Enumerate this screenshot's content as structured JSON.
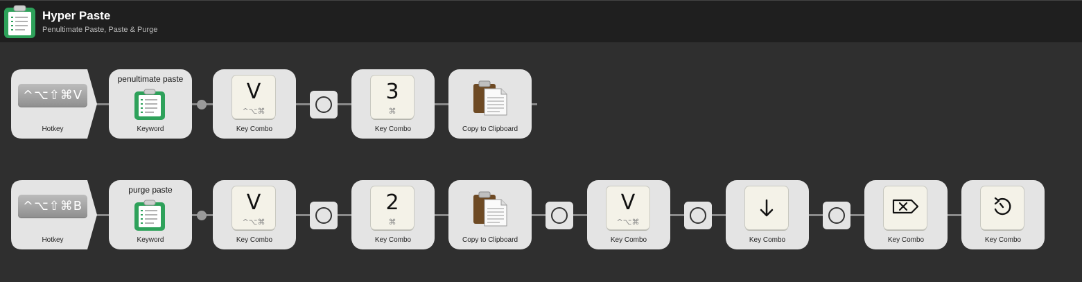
{
  "header": {
    "title": "Hyper Paste",
    "subtitle": "Penultimate Paste, Paste & Purge"
  },
  "rows": [
    {
      "hotkey": {
        "keys": "^⌥⇧⌘V",
        "label": "Hotkey"
      },
      "keyword": {
        "title": "penultimate paste",
        "label": "Keyword"
      },
      "combo1": {
        "key": "V",
        "mods": "^⌥⌘",
        "label": "Key Combo"
      },
      "combo2": {
        "key": "3",
        "mods": "⌘",
        "label": "Key Combo"
      },
      "clipboard": {
        "label": "Copy to Clipboard"
      }
    },
    {
      "hotkey": {
        "keys": "^⌥⇧⌘B",
        "label": "Hotkey"
      },
      "keyword": {
        "title": "purge paste",
        "label": "Keyword"
      },
      "combo1": {
        "key": "V",
        "mods": "^⌥⌘",
        "label": "Key Combo"
      },
      "combo2": {
        "key": "2",
        "mods": "⌘",
        "label": "Key Combo"
      },
      "clipboard": {
        "label": "Copy to Clipboard"
      },
      "combo3": {
        "key": "V",
        "mods": "^⌥⌘",
        "label": "Key Combo"
      },
      "combo4": {
        "icon": "down-arrow-icon",
        "label": "Key Combo"
      },
      "combo5": {
        "icon": "delete-forward-icon",
        "label": "Key Combo"
      },
      "combo6": {
        "icon": "undo-circular-icon",
        "label": "Key Combo"
      }
    }
  ],
  "colors": {
    "header_bg": "#1f1f1f",
    "canvas_bg": "#2f2f2f",
    "node_bg": "#e4e4e4",
    "connector": "#8a8a8a",
    "keyword_green": "#2ea15a",
    "clipboard_brown": "#6e4a24"
  }
}
